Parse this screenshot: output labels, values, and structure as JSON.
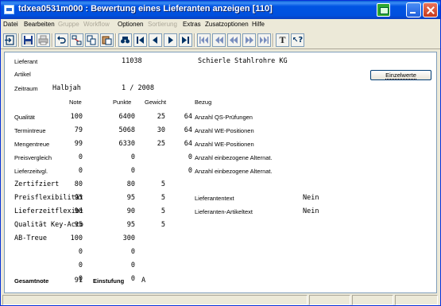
{
  "window": {
    "title": "tdxea0531m000 : Bewertung eines Lieferanten anzeigen [110]"
  },
  "menu": [
    {
      "label": "Datei",
      "enabled": true
    },
    {
      "label": "Bearbeiten",
      "enabled": true
    },
    {
      "label": "Gruppe",
      "enabled": false
    },
    {
      "label": "Workflow",
      "enabled": false
    },
    {
      "label": "Optionen",
      "enabled": true
    },
    {
      "label": "Sortierung",
      "enabled": false
    },
    {
      "label": "Extras",
      "enabled": true
    },
    {
      "label": "Zusatzoptionen",
      "enabled": true
    },
    {
      "label": "Hilfe",
      "enabled": true
    }
  ],
  "toolbar": {
    "text_button": "T",
    "help_button": "?"
  },
  "header": {
    "lieferant_label": "Lieferant",
    "lieferant_code": "11038",
    "lieferant_name": "Schierle Stahlrohre KG",
    "artikel_label": "Artikel",
    "zeitraum_label": "Zeitraum",
    "zeitraum_typ": "Halbjah",
    "zeitraum_wert": "1 /  2008",
    "einzelwerte_button": "Einzelwerte"
  },
  "columns": {
    "note": "Note",
    "punkte": "Punkte",
    "gewicht": "Gewicht",
    "bezug": "Bezug"
  },
  "rows": [
    {
      "label": "Qualität",
      "note": "100",
      "punkte": "6400",
      "gewicht": "25",
      "bezug_wert": "64",
      "bezug_text": "Anzahl QS-Prüfungen"
    },
    {
      "label": "Termintreue",
      "note": "79",
      "punkte": "5068",
      "gewicht": "30",
      "bezug_wert": "64",
      "bezug_text": "Anzahl WE-Positionen"
    },
    {
      "label": "Mengentreue",
      "note": "99",
      "punkte": "6330",
      "gewicht": "25",
      "bezug_wert": "64",
      "bezug_text": "Anzahl WE-Positionen"
    },
    {
      "label": "Preisvergleich",
      "note": "0",
      "punkte": "0",
      "gewicht": "",
      "bezug_wert": "0",
      "bezug_text": "Anzahl einbezogene Alternat."
    },
    {
      "label": "Lieferzeitvgl.",
      "note": "0",
      "punkte": "0",
      "gewicht": "",
      "bezug_wert": "0",
      "bezug_text": "Anzahl einbezogene Alternat."
    },
    {
      "label": "Zertifziert",
      "note": "80",
      "punkte": "80",
      "gewicht": "5",
      "bezug_wert": "",
      "bezug_text": ""
    },
    {
      "label": "Preisflexibilität",
      "note": "95",
      "punkte": "95",
      "gewicht": "5",
      "bezug_wert": "",
      "bezug_text": "Lieferantentext",
      "bezug_flag": "Nein"
    },
    {
      "label": "Lieferzeitflexibi",
      "note": "90",
      "punkte": "90",
      "gewicht": "5",
      "bezug_wert": "",
      "bezug_text": "Lieferanten-Artikeltext",
      "bezug_flag": "Nein"
    },
    {
      "label": "Qualität Key-Acco",
      "note": "95",
      "punkte": "95",
      "gewicht": "5",
      "bezug_wert": "",
      "bezug_text": ""
    },
    {
      "label": "AB-Treue",
      "note": "100",
      "punkte": "300",
      "gewicht": "",
      "bezug_wert": "",
      "bezug_text": ""
    },
    {
      "label": "",
      "note": "0",
      "punkte": "0",
      "gewicht": "",
      "bezug_wert": "",
      "bezug_text": ""
    },
    {
      "label": "",
      "note": "0",
      "punkte": "0",
      "gewicht": "",
      "bezug_wert": "",
      "bezug_text": ""
    },
    {
      "label": "",
      "note": "0",
      "punkte": "0",
      "gewicht": "",
      "bezug_wert": "",
      "bezug_text": ""
    }
  ],
  "footer": {
    "gesamtnote_label": "Gesamtnote",
    "gesamtnote_wert": "91",
    "einstufung_label": "Einstufung",
    "einstufung_wert": "A"
  }
}
